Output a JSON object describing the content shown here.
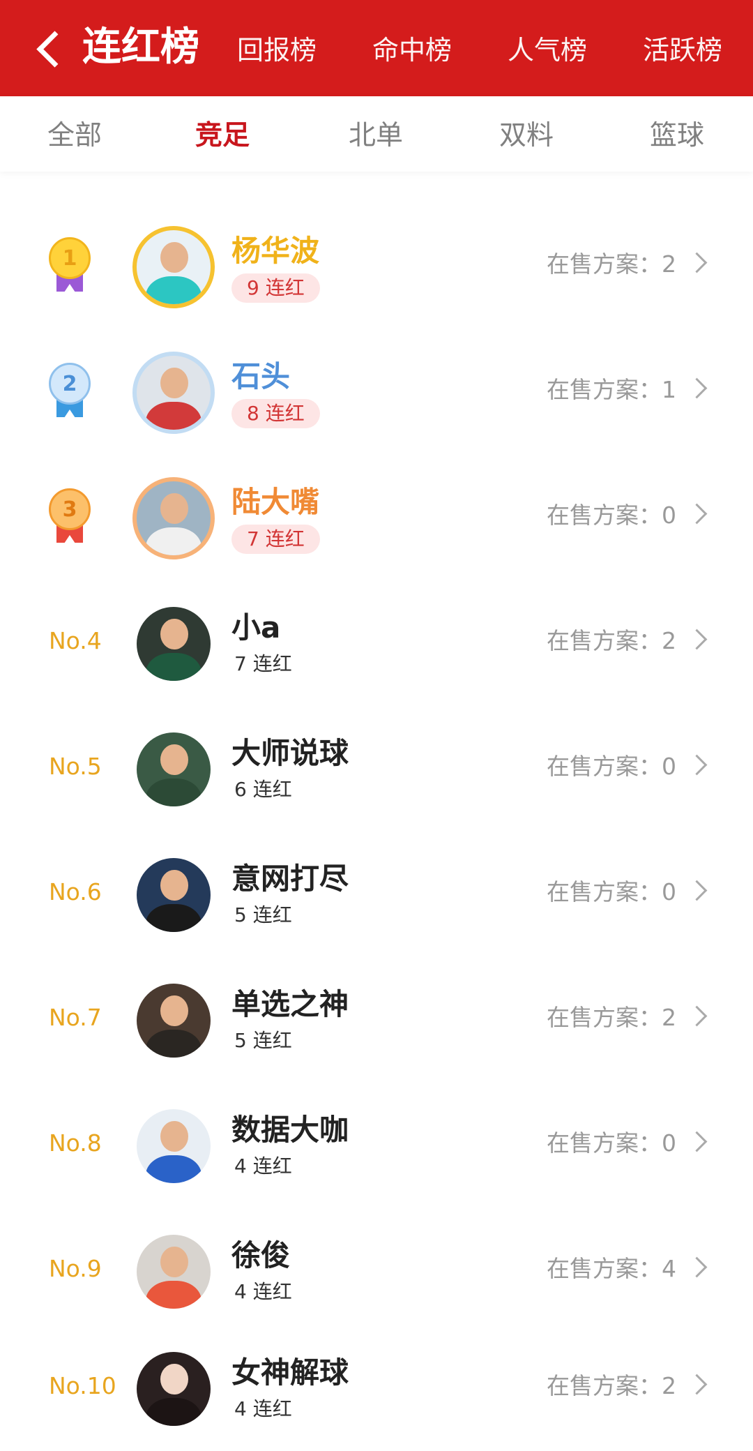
{
  "header": {
    "title": "连红榜",
    "tabs": [
      "回报榜",
      "命中榜",
      "人气榜",
      "活跃榜"
    ]
  },
  "subtabs": [
    "全部",
    "竞足",
    "北单",
    "双料",
    "篮球"
  ],
  "active_subtab": "竞足",
  "sale_label": "在售方案：",
  "colors": {
    "brand": "#d41c1c",
    "rank_gold": "#e8a51f"
  },
  "list": [
    {
      "rank": "1",
      "name": "杨华波",
      "streak": "9 连红",
      "sale_count": "2",
      "name_color": "#f0b21a"
    },
    {
      "rank": "2",
      "name": "石头",
      "streak": "8 连红",
      "sale_count": "1",
      "name_color": "#4f8fd8"
    },
    {
      "rank": "3",
      "name": "陆大嘴",
      "streak": "7 连红",
      "sale_count": "0",
      "name_color": "#f08a35"
    },
    {
      "rank": "No.4",
      "name": "小a",
      "streak": "7 连红",
      "sale_count": "2"
    },
    {
      "rank": "No.5",
      "name": "大师说球",
      "streak": "6 连红",
      "sale_count": "0"
    },
    {
      "rank": "No.6",
      "name": "意网打尽",
      "streak": "5 连红",
      "sale_count": "0"
    },
    {
      "rank": "No.7",
      "name": "单选之神",
      "streak": "5 连红",
      "sale_count": "2"
    },
    {
      "rank": "No.8",
      "name": "数据大咖",
      "streak": "4 连红",
      "sale_count": "0"
    },
    {
      "rank": "No.9",
      "name": "徐俊",
      "streak": "4 连红",
      "sale_count": "4"
    },
    {
      "rank": "No.10",
      "name": "女神解球",
      "streak": "4 连红",
      "sale_count": "2"
    }
  ]
}
